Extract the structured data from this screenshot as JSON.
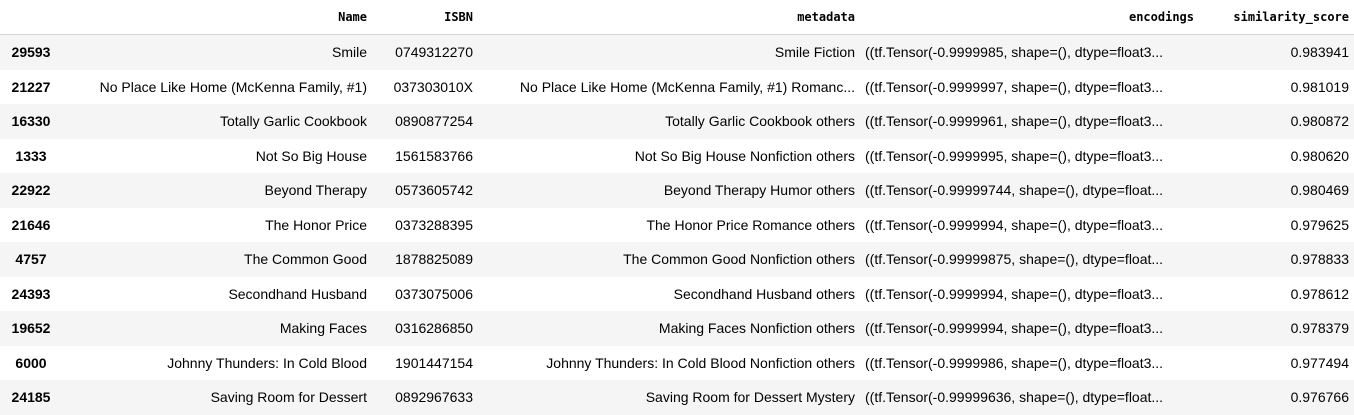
{
  "table": {
    "columns": [
      "",
      "Name",
      "ISBN",
      "metadata",
      "encodings",
      "similarity_score"
    ],
    "rows": [
      {
        "index": "29593",
        "name": "Smile",
        "isbn": "0749312270",
        "metadata": "Smile Fiction",
        "encodings": "((tf.Tensor(-0.9999985, shape=(), dtype=float3...",
        "score": "0.983941"
      },
      {
        "index": "21227",
        "name": "No Place Like Home (McKenna Family, #1)",
        "isbn": "037303010X",
        "metadata": "No Place Like Home (McKenna Family, #1) Romanc...",
        "encodings": "((tf.Tensor(-0.9999997, shape=(), dtype=float3...",
        "score": "0.981019"
      },
      {
        "index": "16330",
        "name": "Totally Garlic Cookbook",
        "isbn": "0890877254",
        "metadata": "Totally Garlic Cookbook others",
        "encodings": "((tf.Tensor(-0.9999961, shape=(), dtype=float3...",
        "score": "0.980872"
      },
      {
        "index": "1333",
        "name": "Not So Big House",
        "isbn": "1561583766",
        "metadata": "Not So Big House Nonfiction others",
        "encodings": "((tf.Tensor(-0.9999995, shape=(), dtype=float3...",
        "score": "0.980620"
      },
      {
        "index": "22922",
        "name": "Beyond Therapy",
        "isbn": "0573605742",
        "metadata": "Beyond Therapy Humor others",
        "encodings": "((tf.Tensor(-0.99999744, shape=(), dtype=float...",
        "score": "0.980469"
      },
      {
        "index": "21646",
        "name": "The Honor Price",
        "isbn": "0373288395",
        "metadata": "The Honor Price Romance others",
        "encodings": "((tf.Tensor(-0.9999994, shape=(), dtype=float3...",
        "score": "0.979625"
      },
      {
        "index": "4757",
        "name": "The Common Good",
        "isbn": "1878825089",
        "metadata": "The Common Good Nonfiction others",
        "encodings": "((tf.Tensor(-0.99999875, shape=(), dtype=float...",
        "score": "0.978833"
      },
      {
        "index": "24393",
        "name": "Secondhand Husband",
        "isbn": "0373075006",
        "metadata": "Secondhand Husband others",
        "encodings": "((tf.Tensor(-0.9999994, shape=(), dtype=float3...",
        "score": "0.978612"
      },
      {
        "index": "19652",
        "name": "Making Faces",
        "isbn": "0316286850",
        "metadata": "Making Faces Nonfiction others",
        "encodings": "((tf.Tensor(-0.9999994, shape=(), dtype=float3...",
        "score": "0.978379"
      },
      {
        "index": "6000",
        "name": "Johnny Thunders: In Cold Blood",
        "isbn": "1901447154",
        "metadata": "Johnny Thunders: In Cold Blood Nonfiction others",
        "encodings": "((tf.Tensor(-0.9999986, shape=(), dtype=float3...",
        "score": "0.977494"
      },
      {
        "index": "24185",
        "name": "Saving Room for Dessert",
        "isbn": "0892967633",
        "metadata": "Saving Room for Dessert Mystery",
        "encodings": "((tf.Tensor(-0.99999636, shape=(), dtype=float...",
        "score": "0.976766"
      }
    ]
  }
}
